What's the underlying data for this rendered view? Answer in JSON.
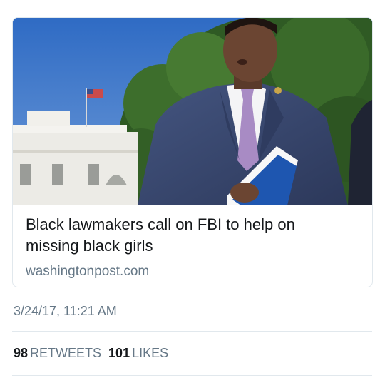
{
  "link_card": {
    "title": "Black lawmakers call on FBI to help on missing black girls",
    "domain": "washingtonpost.com"
  },
  "tweet_meta": {
    "timestamp": "3/24/17, 11:21 AM"
  },
  "stats": {
    "retweets_count": "98",
    "retweets_label": "RETWEETS",
    "likes_count": "101",
    "likes_label": "LIKES"
  },
  "colors": {
    "text_primary": "#14171a",
    "text_secondary": "#657786",
    "border": "#e1e8ed",
    "sky": "#3f78c8",
    "suit": "#3b4a6e",
    "tie": "#a88bc4"
  }
}
